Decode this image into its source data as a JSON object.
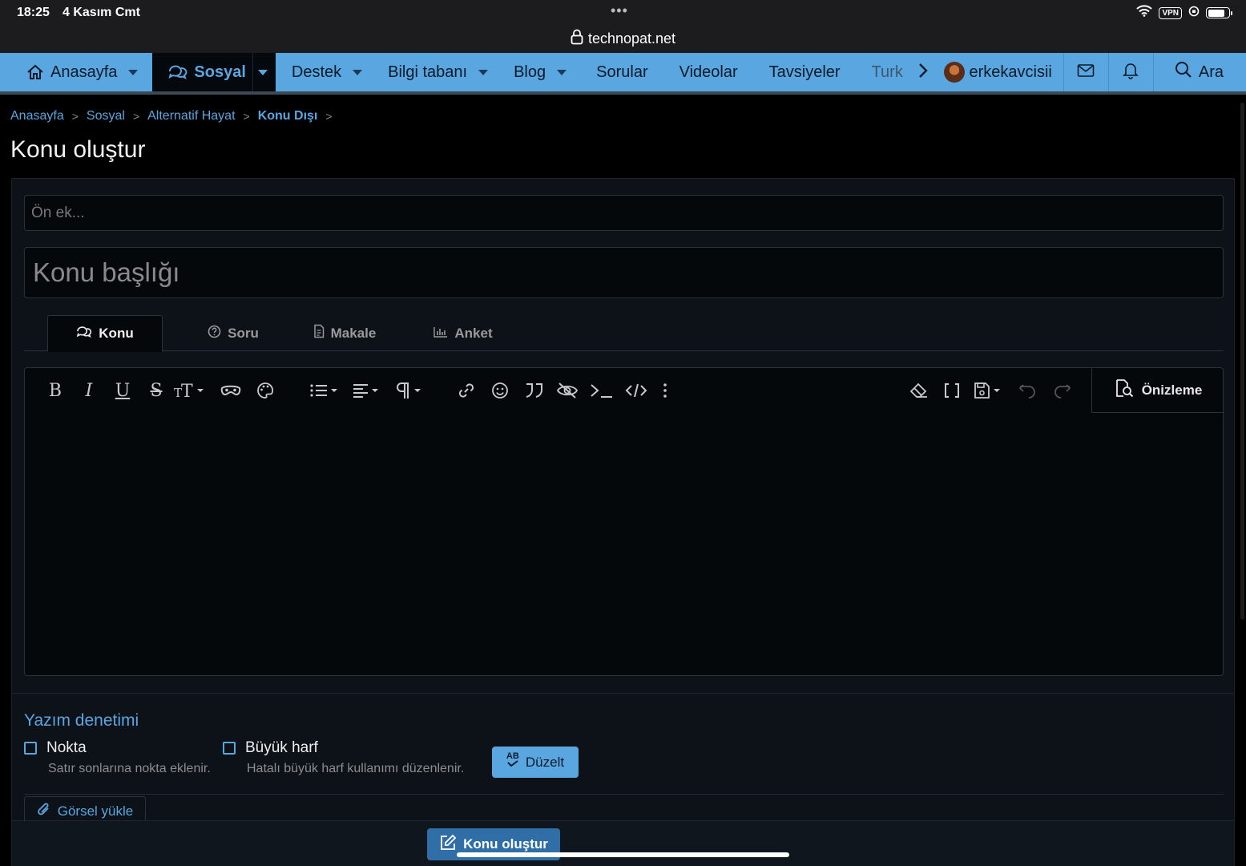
{
  "status": {
    "time": "18:25",
    "date": "4 Kasım Cmt",
    "url": "technopat.net",
    "vpn": "VPN"
  },
  "nav": {
    "items": [
      {
        "label": "Anasayfa"
      },
      {
        "label": "Sosyal"
      },
      {
        "label": "Destek"
      },
      {
        "label": "Bilgi tabanı"
      },
      {
        "label": "Blog"
      },
      {
        "label": "Sorular"
      },
      {
        "label": "Videolar"
      },
      {
        "label": "Tavsiyeler"
      },
      {
        "label": "Turk"
      }
    ],
    "username": "erkekavcisii",
    "search_label": "Ara"
  },
  "breadcrumb": {
    "items": [
      "Anasayfa",
      "Sosyal",
      "Alternatif Hayat"
    ],
    "current": "Konu Dışı"
  },
  "page_title": "Konu oluştur",
  "form": {
    "prefix_placeholder": "Ön ek...",
    "title_placeholder": "Konu başlığı",
    "tabs": [
      {
        "label": "Konu"
      },
      {
        "label": "Soru"
      },
      {
        "label": "Makale"
      },
      {
        "label": "Anket"
      }
    ],
    "preview_label": "Önizleme"
  },
  "spell": {
    "title": "Yazım denetimi",
    "options": [
      {
        "label": "Nokta",
        "hint": "Satır sonlarına nokta eklenir."
      },
      {
        "label": "Büyük harf",
        "hint": "Hatalı büyük harf kullanımı düzenlenir."
      }
    ],
    "fix_label": "Düzelt",
    "fix_badge": "AB"
  },
  "upload_label": "Görsel yükle",
  "submit_label": "Konu oluştur",
  "colors": {
    "accent": "#5aa6e0",
    "background": "#000000",
    "panel": "#0d1218"
  }
}
